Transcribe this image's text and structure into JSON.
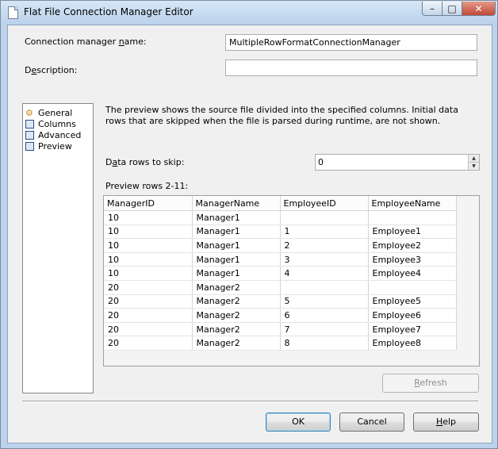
{
  "window": {
    "title": "Flat File Connection Manager Editor",
    "controls": {
      "minimize": "–",
      "maximize": "□",
      "close": "✕"
    }
  },
  "form": {
    "conn_name_label": {
      "before": "Connection manager ",
      "accel": "n",
      "after": "ame:"
    },
    "conn_name_value": "MultipleRowFormatConnectionManager",
    "description_label": {
      "before": "D",
      "accel": "e",
      "after": "scription:"
    },
    "description_value": ""
  },
  "nav": {
    "items": [
      {
        "label": "General",
        "icon": "general-icon"
      },
      {
        "label": "Columns",
        "icon": "columns-icon"
      },
      {
        "label": "Advanced",
        "icon": "advanced-icon"
      },
      {
        "label": "Preview",
        "icon": "preview-icon"
      }
    ]
  },
  "preview": {
    "description": "The preview shows the source file divided into the specified columns. Initial data rows that are skipped when the file is parsed during runtime, are not shown.",
    "skip_label": {
      "before": "D",
      "accel": "a",
      "after": "ta rows to skip:"
    },
    "skip_value": "0",
    "rows_label": "Preview rows 2-11:",
    "columns": [
      "ManagerID",
      "ManagerName",
      "EmployeeID",
      "EmployeeName"
    ],
    "rows": [
      [
        "10",
        "Manager1",
        "",
        ""
      ],
      [
        "10",
        "Manager1",
        "1",
        "Employee1"
      ],
      [
        "10",
        "Manager1",
        "2",
        "Employee2"
      ],
      [
        "10",
        "Manager1",
        "3",
        "Employee3"
      ],
      [
        "10",
        "Manager1",
        "4",
        "Employee4"
      ],
      [
        "20",
        "Manager2",
        "",
        ""
      ],
      [
        "20",
        "Manager2",
        "5",
        "Employee5"
      ],
      [
        "20",
        "Manager2",
        "6",
        "Employee6"
      ],
      [
        "20",
        "Manager2",
        "7",
        "Employee7"
      ],
      [
        "20",
        "Manager2",
        "8",
        "Employee8"
      ]
    ]
  },
  "buttons": {
    "refresh": {
      "before": "",
      "accel": "R",
      "after": "efresh"
    },
    "ok": "OK",
    "cancel": "Cancel",
    "help": {
      "before": "",
      "accel": "H",
      "after": "elp"
    }
  }
}
